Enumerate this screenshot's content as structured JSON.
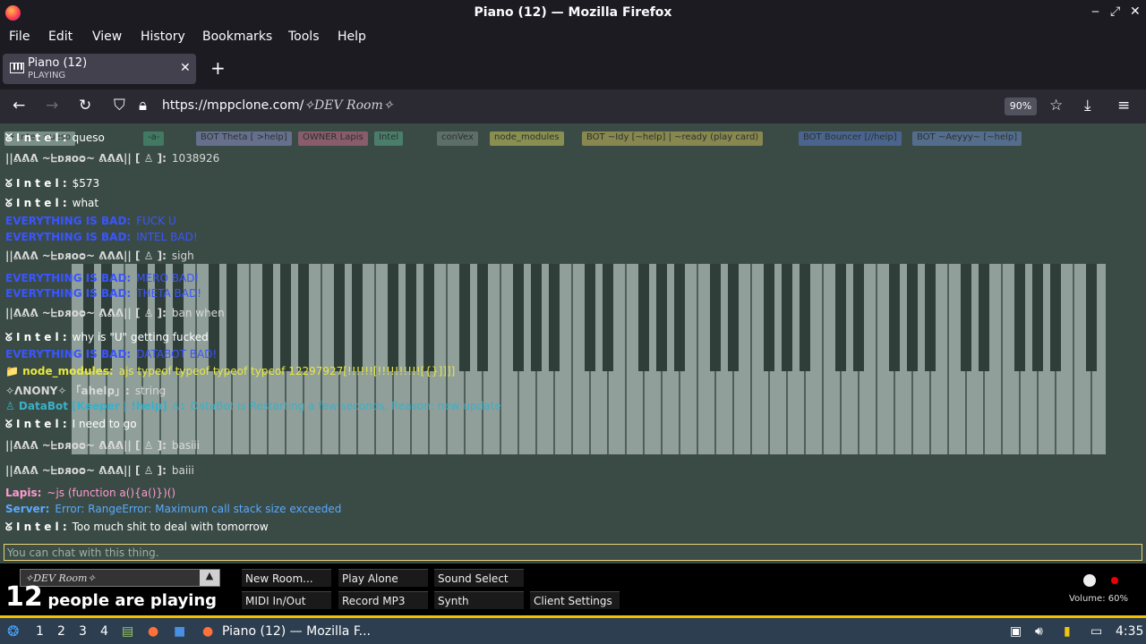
{
  "window": {
    "title": "Piano (12) — Mozilla Firefox"
  },
  "menu": [
    "File",
    "Edit",
    "View",
    "History",
    "Bookmarks",
    "Tools",
    "Help"
  ],
  "tab": {
    "title": "Piano (12)",
    "status": "PLAYING"
  },
  "nav": {
    "url_prefix": "https://mppclone.com/",
    "url_room": "✧DEV Room✧",
    "zoom": "90%"
  },
  "players_bar": [
    {
      "label": "⚡ Intel: queso",
      "color": "#aec8c0"
    },
    {
      "label": "-a-",
      "color": "#4aa07a"
    },
    {
      "label": "BOT Theta [ >help]",
      "color": "#8a8fc8"
    },
    {
      "label": "OWNER Lapis",
      "color": "#c86a8a"
    },
    {
      "label": "Intel",
      "color": "#5aa68a"
    },
    {
      "label": "conVex",
      "color": "#7a8a84"
    },
    {
      "label": "node_modules",
      "color": "#c8c85a"
    },
    {
      "label": "BOT ~Idy [~help] | ~ready (play card)",
      "color": "#c8b85a"
    },
    {
      "label": "BOT Bouncer [//help]",
      "color": "#5a7ac8"
    },
    {
      "label": "BOT ~Aeyyy~ [~help]",
      "color": "#6a8ac8"
    }
  ],
  "chat": [
    {
      "name": "ᘜ I n t e l :",
      "text": "queso",
      "name_color": "#ffffff",
      "text_color": "#ffffff"
    },
    {
      "name": "||ᕕᕕᕕ ~ᖶᴅᴙᴏᴑ~ ᕕᕕᕕ|| [ ♙ ]:",
      "text": "1038926",
      "name_color": "#d8d8d8",
      "text_color": "#d8d8d8"
    },
    {
      "name": "ᘜ I n t e l :",
      "text": "$573",
      "name_color": "#ffffff",
      "text_color": "#ffffff"
    },
    {
      "name": "ᘜ I n t e l :",
      "text": "what",
      "name_color": "#ffffff",
      "text_color": "#ffffff"
    },
    {
      "name": "EVERYTHING IS BAD:",
      "text": "FUCK U",
      "name_color": "#3a55ff",
      "text_color": "#3a55ff"
    },
    {
      "name": "EVERYTHING IS BAD:",
      "text": "INTEL BAD!",
      "name_color": "#3a55ff",
      "text_color": "#3a55ff"
    },
    {
      "name": "||ᕕᕕᕕ ~ᖶᴅᴙᴏᴑ~ ᕕᕕᕕ|| [ ♙ ]:",
      "text": "sigh",
      "name_color": "#d8d8d8",
      "text_color": "#d8d8d8"
    },
    {
      "name": "EVERYTHING IS BAD:",
      "text": "MERO BAD!",
      "name_color": "#3a55ff",
      "text_color": "#3a55ff"
    },
    {
      "name": "EVERYTHING IS BAD:",
      "text": "THETA BAD!",
      "name_color": "#3a55ff",
      "text_color": "#3a55ff"
    },
    {
      "name": "||ᕕᕕᕕ ~ᖶᴅᴙᴏᴑ~ ᕕᕕᕕ|| [ ♙ ]:",
      "text": "ban when",
      "name_color": "#d8d8d8",
      "text_color": "#d8d8d8"
    },
    {
      "name": "ᘜ I n t e l :",
      "text": "why is \"U\" getting fucked",
      "name_color": "#ffffff",
      "text_color": "#ffffff"
    },
    {
      "name": "EVERYTHING IS BAD:",
      "text": "DATABOT BAD!",
      "name_color": "#3a55ff",
      "text_color": "#3a55ff"
    },
    {
      "name": "📁 node_modules:",
      "text": "ajs typeof typeof typeof typeof 12297927[!!!!!![!!!!!!!!!![{}]]]]",
      "name_color": "#e8e83a",
      "text_color": "#e8e83a"
    },
    {
      "name": "✧ΛNONY✧ 「ahelp」:",
      "text": "string",
      "name_color": "#d8d8d8",
      "text_color": "#d8d8d8"
    },
    {
      "name": "♙ DataBot [Keeper | !help] ♙:",
      "text": "DataBot is Restarting a few seconds. Reason: new update",
      "name_color": "#3ab0c8",
      "text_color": "#3ab0c8"
    },
    {
      "name": "ᘜ I n t e l :",
      "text": "I need to go",
      "name_color": "#ffffff",
      "text_color": "#ffffff"
    },
    {
      "name": "||ᕕᕕᕕ ~ᖶᴅᴙᴏᴑ~ ᕕᕕᕕ|| [ ♙ ]:",
      "text": "basiii",
      "name_color": "#d8d8d8",
      "text_color": "#d8d8d8"
    },
    {
      "name": "||ᕕᕕᕕ ~ᖶᴅᴙᴏᴑ~ ᕕᕕᕕ|| [ ♙ ]:",
      "text": "baiii",
      "name_color": "#d8d8d8",
      "text_color": "#d8d8d8"
    },
    {
      "name": "Lapis:",
      "text": "~js (function a(){a()})()",
      "name_color": "#ff9ad0",
      "text_color": "#ff9ad0"
    },
    {
      "name": "Server:",
      "text": "Error: RangeError: Maximum call stack size exceeded",
      "name_color": "#5aa8ff",
      "text_color": "#5aa8ff"
    },
    {
      "name": "ᘜ I n t e l :",
      "text": "Too much shit to deal with tomorrow",
      "name_color": "#ffffff",
      "text_color": "#ffffff"
    }
  ],
  "chat_input": {
    "placeholder": "You can chat with this thing."
  },
  "controls": {
    "room": "✧DEV Room✧",
    "players_count": "12",
    "players_text": "people are playing",
    "buttons": [
      "New Room...",
      "Play Alone",
      "Sound Select",
      "MIDI In/Out",
      "Record MP3",
      "Synth",
      "Client Settings"
    ],
    "volume": "Volume: 60%"
  },
  "taskbar": {
    "workspaces": [
      "1",
      "2",
      "3",
      "4"
    ],
    "window_label": "Piano (12) — Mozilla F...",
    "clock": "4:35"
  }
}
